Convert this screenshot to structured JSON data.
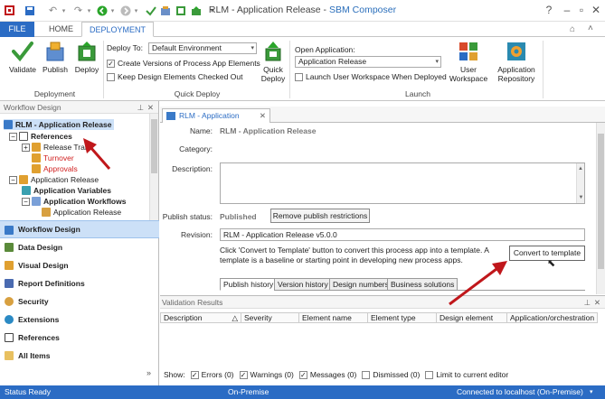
{
  "window": {
    "title_main": "RLM - Application Release",
    "title_sep": " - ",
    "title_brand": "SBM Composer",
    "help": "?"
  },
  "ribbon_tabs": [
    "FILE",
    "HOME",
    "DEPLOYMENT"
  ],
  "ribbon": {
    "validate": "Validate",
    "publish": "Publish",
    "deploy": "Deploy",
    "group_deployment": "Deployment",
    "deploy_to_label": "Deploy To:",
    "deploy_to_value": "Default Environment",
    "create_versions": "Create Versions of Process App Elements",
    "keep_checked_out": "Keep Design Elements Checked Out",
    "quick_deploy_line1": "Quick",
    "quick_deploy_line2": "Deploy",
    "group_quick_deploy": "Quick Deploy",
    "open_app_label": "Open Application:",
    "open_app_value": "Application Release",
    "launch_workspace": "Launch User Workspace When Deployed",
    "user_workspace_line1": "User",
    "user_workspace_line2": "Workspace",
    "app_repo_line1": "Application",
    "app_repo_line2": "Repository",
    "group_launch": "Launch"
  },
  "left_panel": {
    "header": "Workflow Design",
    "tree": [
      {
        "label": "RLM - Application Release",
        "bold": true,
        "selected": true
      },
      {
        "label": "References",
        "bold": true
      },
      {
        "label": "Release Train",
        "bold": false
      },
      {
        "label": "Turnover",
        "bold": false,
        "color": "#d02020"
      },
      {
        "label": "Approvals",
        "bold": false,
        "color": "#d02020"
      },
      {
        "label": "Application Release",
        "bold": false
      },
      {
        "label": "Application Variables",
        "bold": true
      },
      {
        "label": "Application Workflows",
        "bold": true
      },
      {
        "label": "Application Release",
        "bold": false
      }
    ],
    "nav": [
      {
        "label": "Workflow Design",
        "icon": "workflow-design-icon",
        "selected": true
      },
      {
        "label": "Data Design",
        "icon": "data-design-icon"
      },
      {
        "label": "Visual Design",
        "icon": "visual-design-icon"
      },
      {
        "label": "Report Definitions",
        "icon": "report-definitions-icon"
      },
      {
        "label": "Security",
        "icon": "security-icon"
      },
      {
        "label": "Extensions",
        "icon": "extensions-icon"
      },
      {
        "label": "References",
        "icon": "references-icon"
      },
      {
        "label": "All Items",
        "icon": "all-items-icon"
      }
    ]
  },
  "doc_tab": "RLM - Application Release",
  "editor": {
    "name_label": "Name:",
    "name_value": "RLM - Application Release",
    "category_label": "Category:",
    "description_label": "Description:",
    "publish_status_label": "Publish status:",
    "publish_status_value": "Published",
    "remove_restrictions": "Remove publish restrictions",
    "revision_label": "Revision:",
    "revision_value": "RLM - Application Release v5.0.0",
    "convert_text": "Click 'Convert to Template' button to convert this process app into a template. A template is a baseline or starting point in developing new process apps.",
    "convert_button": "Convert to template",
    "subtabs": [
      "Publish history",
      "Version history",
      "Design numbers",
      "Business solutions"
    ]
  },
  "validation": {
    "header": "Validation Results",
    "columns": [
      "Description",
      "Severity",
      "Element name",
      "Element type",
      "Design element",
      "Application/orchestration"
    ],
    "show_label": "Show:",
    "filters": [
      {
        "label": "Errors (0)",
        "checked": true
      },
      {
        "label": "Warnings (0)",
        "checked": true
      },
      {
        "label": "Messages (0)",
        "checked": true
      },
      {
        "label": "Dismissed (0)",
        "checked": false
      },
      {
        "label": "Limit to current editor",
        "checked": false
      }
    ]
  },
  "status": {
    "left": "Status Ready",
    "center": "On-Premise",
    "right": "Connected to localhost (On-Premise)"
  },
  "colors": {
    "accent": "#2b6cc4",
    "annotation": "#c0171b"
  }
}
